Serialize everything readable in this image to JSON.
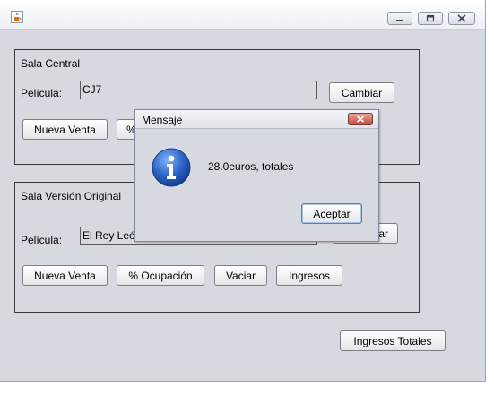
{
  "window": {
    "icon": "java-cup-icon",
    "controls": [
      "minimize-icon",
      "maximize-icon",
      "close-icon"
    ]
  },
  "sala_central": {
    "title": "Sala Central",
    "pelicula_label": "Película:",
    "pelicula_value": "CJ7",
    "cambiar_label": "Cambiar",
    "nueva_venta_label": "Nueva Venta",
    "ocupacion_label": "%"
  },
  "sala_vo": {
    "title": "Sala Versión Original",
    "pelicula_label": "Película:",
    "pelicula_value": "El Rey Leó",
    "cambiar_label": "ar",
    "nueva_venta_label": "Nueva Venta",
    "ocupacion_label": "% Ocupación",
    "vaciar_label": "Vaciar",
    "ingresos_label": "Ingresos"
  },
  "ingresos_totales_label": "Ingresos Totales",
  "dialog": {
    "title": "Mensaje",
    "message": "28.0euros, totales",
    "accept_label": "Aceptar",
    "icon": "info-icon"
  }
}
